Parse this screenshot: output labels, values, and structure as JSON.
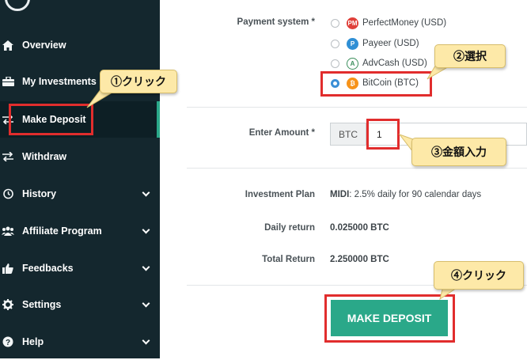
{
  "sidebar": {
    "items": [
      {
        "label": "Overview",
        "icon": "home-icon",
        "chevron": false
      },
      {
        "label": "My Investments",
        "icon": "briefcase-icon",
        "chevron": false
      },
      {
        "label": "Make Deposit",
        "icon": "exchange-icon",
        "chevron": false,
        "active": true
      },
      {
        "label": "Withdraw",
        "icon": "exchange-icon",
        "chevron": false
      },
      {
        "label": "History",
        "icon": "history-icon",
        "chevron": true
      },
      {
        "label": "Affiliate Program",
        "icon": "users-icon",
        "chevron": true
      },
      {
        "label": "Feedbacks",
        "icon": "thumbs-up-icon",
        "chevron": true
      },
      {
        "label": "Settings",
        "icon": "gear-icon",
        "chevron": true
      },
      {
        "label": "Help",
        "icon": "question-icon",
        "chevron": true
      }
    ],
    "accent_color": "#2aa889"
  },
  "form": {
    "payment_label": "Payment system *",
    "payment_options": [
      {
        "label": "PerfectMoney (USD)",
        "icon_text": "PM",
        "color": "#e0403a",
        "selected": false
      },
      {
        "label": "Payeer (USD)",
        "icon_text": "P",
        "color": "#2f8fd5",
        "selected": false
      },
      {
        "label": "AdvCash (USD)",
        "icon_text": "A",
        "color": "#3c8f5c",
        "selected": false
      },
      {
        "label": "BitCoin (BTC)",
        "icon_text": "₿",
        "color": "#f7931a",
        "selected": true
      }
    ],
    "amount_label": "Enter Amount *",
    "currency": "BTC",
    "amount_value": "1",
    "plan_label": "Investment Plan",
    "plan_name": "MIDI",
    "plan_desc": ": 2.5% daily for 90 calendar days",
    "daily_label": "Daily return",
    "daily_value": "0.025000 BTC",
    "total_label": "Total Return",
    "total_value": "2.250000 BTC",
    "submit_label": "MAKE DEPOSIT",
    "submit_color": "#2aa889"
  },
  "annotations": {
    "step1": "①クリック",
    "step2": "②選択",
    "step3": "③金額入力",
    "step4": "④クリック",
    "highlight_color": "#e12d2d",
    "callout_color": "#fde9a8"
  }
}
